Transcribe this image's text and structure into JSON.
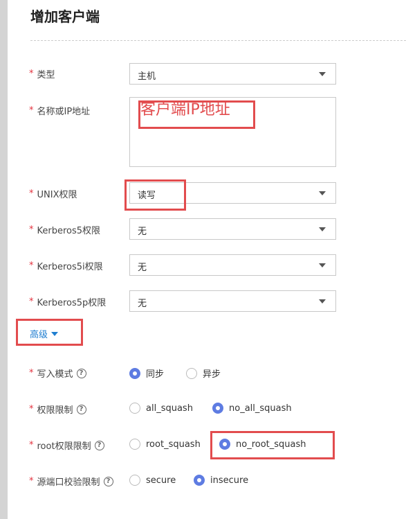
{
  "title": "增加客户端",
  "fields": {
    "type": {
      "label": "类型",
      "value": "主机"
    },
    "name": {
      "label": "名称或IP地址",
      "annotation": "客户端IP地址"
    },
    "unix": {
      "label": "UNIX权限",
      "value": "读写"
    },
    "krb5": {
      "label": "Kerberos5权限",
      "value": "无"
    },
    "krb5i": {
      "label": "Kerberos5i权限",
      "value": "无"
    },
    "krb5p": {
      "label": "Kerberos5p权限",
      "value": "无"
    }
  },
  "required_mark": "*",
  "advanced_label": "高级",
  "radios": {
    "write_mode": {
      "label": "写入模式",
      "options": [
        "同步",
        "异步"
      ],
      "selected": 0
    },
    "squash": {
      "label": "权限限制",
      "options": [
        "all_squash",
        "no_all_squash"
      ],
      "selected": 1
    },
    "root_squash": {
      "label": "root权限限制",
      "options": [
        "root_squash",
        "no_root_squash"
      ],
      "selected": 1
    },
    "secure": {
      "label": "源端口校验限制",
      "options": [
        "secure",
        "insecure"
      ],
      "selected": 1
    }
  },
  "help_glyph": "?",
  "colors": {
    "required": "#e3323e",
    "highlight": "#e24c4e",
    "link": "#1f7ed0",
    "radio_selected": "#5e7ce2"
  }
}
